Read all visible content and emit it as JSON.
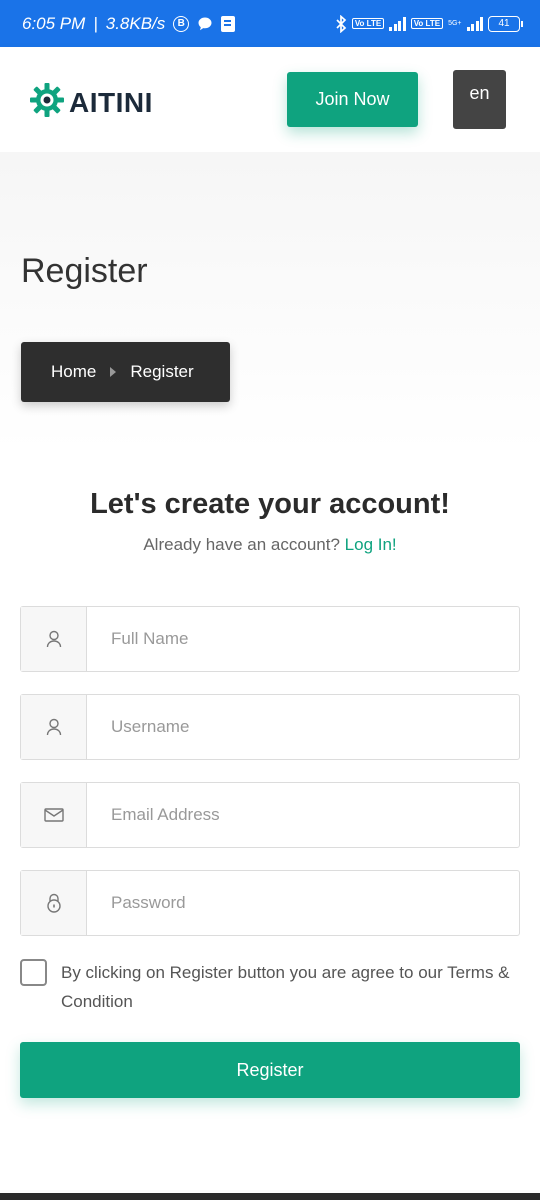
{
  "status_bar": {
    "time": "6:05 PM",
    "divider": "|",
    "speed": "3.8KB/s",
    "b_badge": "B",
    "lte_1": "Vo LTE",
    "lte_2": "Vo LTE",
    "net_5g": "5G+",
    "battery": "41",
    "icons": [
      "bluetooth-icon",
      "chat-icon",
      "note-icon",
      "signal-icon",
      "battery-icon"
    ]
  },
  "header": {
    "logo_text": "AITINI",
    "join_label": "Join Now",
    "lang_label": "en"
  },
  "hero": {
    "title": "Register",
    "breadcrumb": [
      "Home",
      "Register"
    ]
  },
  "form": {
    "title": "Let's create your account!",
    "subtitle_prefix": "Already have an account? ",
    "login_link": "Log In!",
    "fields": [
      {
        "icon": "user-icon",
        "placeholder": "Full Name"
      },
      {
        "icon": "user-icon",
        "placeholder": "Username"
      },
      {
        "icon": "mail-icon",
        "placeholder": "Email Address"
      },
      {
        "icon": "lock-icon",
        "placeholder": "Password"
      }
    ],
    "agree_text": "By clicking on Register button you are agree to our Terms & Condition",
    "submit_label": "Register"
  },
  "colors": {
    "accent": "#0fa37f",
    "status_bar": "#1a73e8",
    "dark": "#2e2e2e"
  }
}
